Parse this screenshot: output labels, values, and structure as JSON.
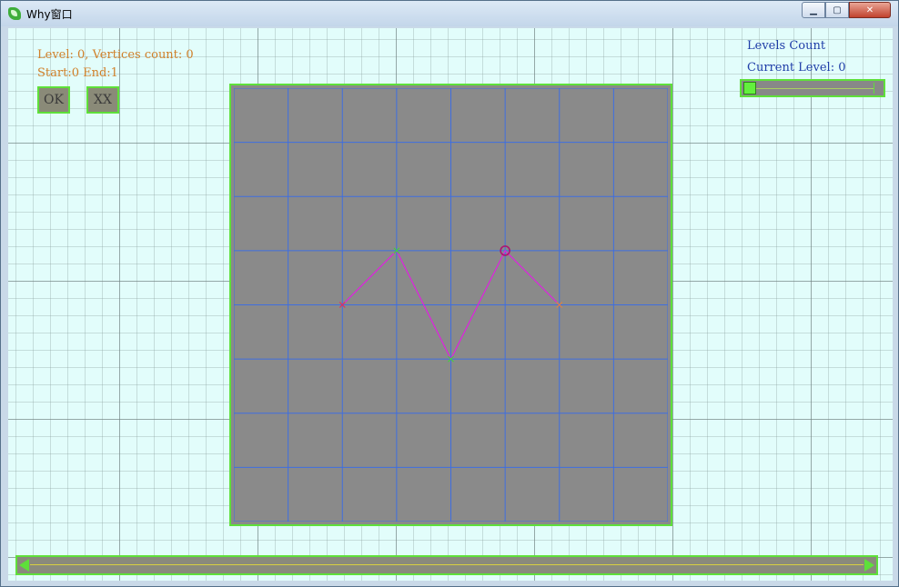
{
  "window": {
    "title": "Why窗口",
    "minimize_label": "▁",
    "maximize_label": "▢",
    "close_label": "✕"
  },
  "info": {
    "line1": "Level: 0, Vertices count: 0",
    "line2": "Start:0 End:1"
  },
  "buttons": {
    "ok_label": "OK",
    "xx_label": "XX"
  },
  "levels": {
    "count_label": "Levels Count",
    "current_label": "Current Level: 0",
    "slider_value": 0
  },
  "board": {
    "cols": 8,
    "rows": 8,
    "colors": {
      "background": "#8a8a8a",
      "grid": "#3f6ee0",
      "border": "#5ee03a",
      "path": "#e020e0"
    },
    "path_points": [
      [
        2,
        4
      ],
      [
        3,
        3
      ],
      [
        4,
        5
      ],
      [
        5,
        3
      ],
      [
        6,
        4
      ]
    ],
    "markers": [
      {
        "pt": [
          2,
          4
        ],
        "kind": "cross",
        "color": "#e03060"
      },
      {
        "pt": [
          3,
          3
        ],
        "kind": "cross",
        "color": "#40d040"
      },
      {
        "pt": [
          4,
          5
        ],
        "kind": "cross",
        "color": "#40d040"
      },
      {
        "pt": [
          5,
          3
        ],
        "kind": "circle",
        "color": "#b01070"
      },
      {
        "pt": [
          6,
          4
        ],
        "kind": "cross",
        "color": "#e08040"
      }
    ]
  },
  "scrollbar": {
    "position": 0
  },
  "colors": {
    "accent": "#5ee03a",
    "client_bg": "#e2fdfb",
    "info_text": "#d0802a",
    "right_text": "#1f3da8"
  }
}
